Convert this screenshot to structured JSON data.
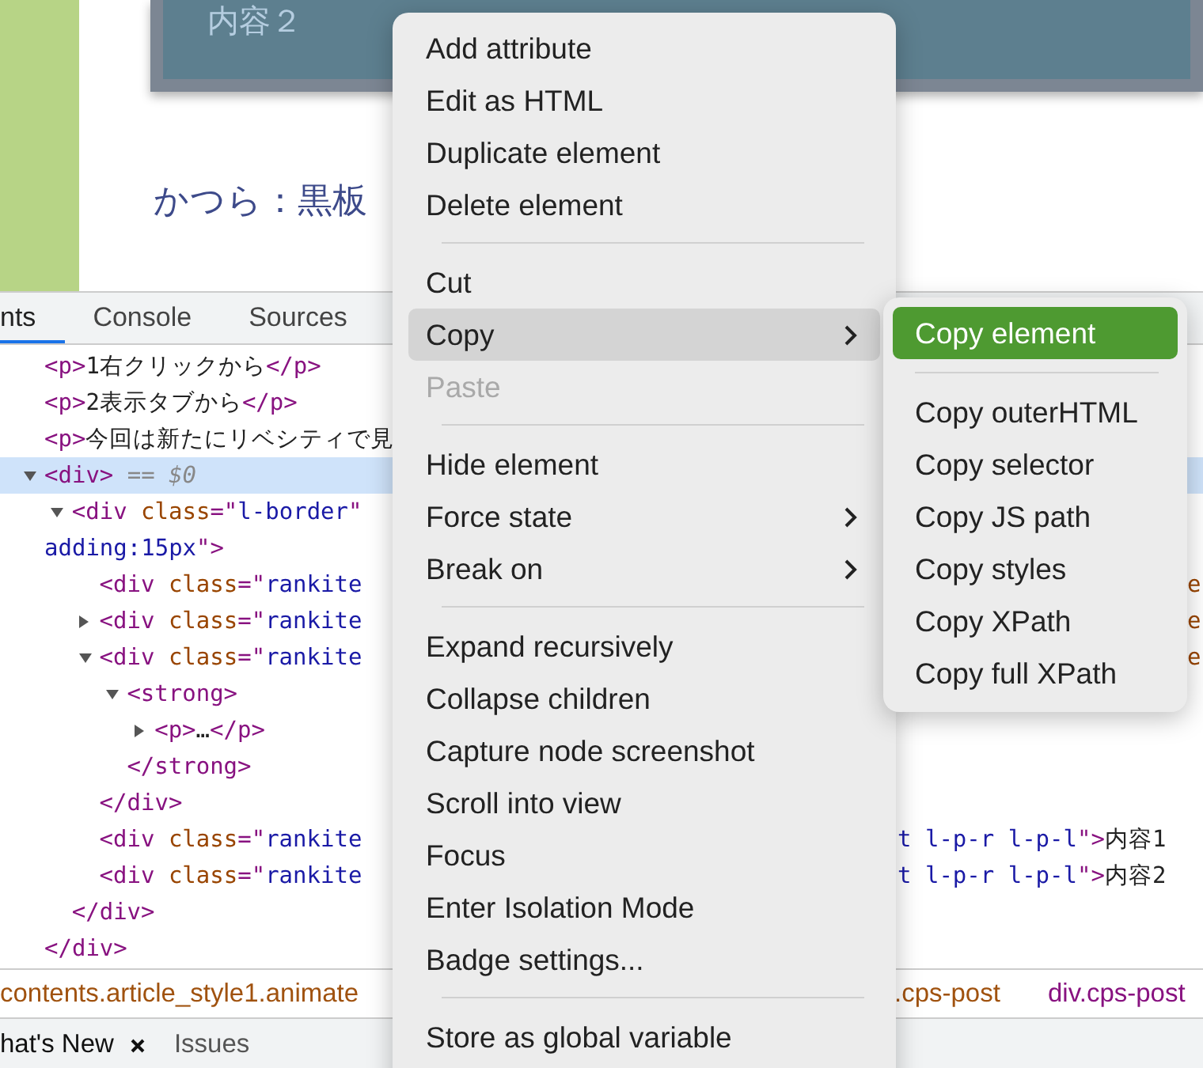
{
  "page": {
    "card_text": "内容２",
    "heading": "かつら：黒板"
  },
  "devtools": {
    "tabs": [
      {
        "label": "nts",
        "selected": true
      },
      {
        "label": "Console",
        "selected": false
      },
      {
        "label": "Sources",
        "selected": false
      }
    ],
    "nodes": [
      {
        "selected": false,
        "lines": [
          [
            {
              "kind": "tag",
              "text": "<p>"
            },
            {
              "kind": "text",
              "text": "1右クリックから"
            },
            {
              "kind": "tag",
              "text": "</p>"
            }
          ]
        ]
      },
      {
        "selected": false,
        "lines": [
          [
            {
              "kind": "tag",
              "text": "<p>"
            },
            {
              "kind": "text",
              "text": "2表示タブから"
            },
            {
              "kind": "tag",
              "text": "</p>"
            }
          ]
        ]
      },
      {
        "selected": false,
        "lines": [
          [
            {
              "kind": "tag",
              "text": "<p>"
            },
            {
              "kind": "text",
              "text": "今回は新たにリベシティで見"
            }
          ]
        ]
      },
      {
        "selected": true,
        "expanded": true,
        "lines": [
          [
            {
              "kind": "tag",
              "text": "<div>"
            },
            {
              "kind": "marker",
              "text": " == $0"
            }
          ]
        ],
        "close": [
          {
            "kind": "tag",
            "text": "</div>"
          }
        ],
        "children": [
          {
            "selected": false,
            "expanded": true,
            "lines": [
              [
                {
                  "kind": "tag",
                  "text": "<div "
                },
                {
                  "kind": "attr",
                  "text": "class"
                },
                {
                  "kind": "tag",
                  "text": "=\""
                },
                {
                  "kind": "value",
                  "text": "l-border"
                },
                {
                  "kind": "tag",
                  "text": "\""
                }
              ],
              [
                {
                  "kind": "value",
                  "text": "adding:15px"
                },
                {
                  "kind": "tag",
                  "text": "\">"
                }
              ]
            ],
            "close": [
              {
                "kind": "tag",
                "text": "</div>"
              }
            ],
            "children": [
              {
                "selected": false,
                "lines": [
                  [
                    {
                      "kind": "tag",
                      "text": "<div "
                    },
                    {
                      "kind": "attr",
                      "text": "class"
                    },
                    {
                      "kind": "tag",
                      "text": "=\""
                    },
                    {
                      "kind": "value",
                      "text": "rankite"
                    }
                  ]
                ],
                "at_edge": [
                  {
                    "kind": "attr",
                    "text": "e"
                  }
                ]
              },
              {
                "selected": false,
                "expanded": false,
                "lines": [
                  [
                    {
                      "kind": "tag",
                      "text": "<div "
                    },
                    {
                      "kind": "attr",
                      "text": "class"
                    },
                    {
                      "kind": "tag",
                      "text": "=\""
                    },
                    {
                      "kind": "value",
                      "text": "rankite"
                    }
                  ]
                ],
                "at_edge": [
                  {
                    "kind": "attr",
                    "text": "e"
                  }
                ]
              },
              {
                "selected": false,
                "expanded": true,
                "lines": [
                  [
                    {
                      "kind": "tag",
                      "text": "<div "
                    },
                    {
                      "kind": "attr",
                      "text": "class"
                    },
                    {
                      "kind": "tag",
                      "text": "=\""
                    },
                    {
                      "kind": "value",
                      "text": "rankite"
                    }
                  ]
                ],
                "at_edge": [
                  {
                    "kind": "attr",
                    "text": "e"
                  }
                ],
                "close": [
                  {
                    "kind": "tag",
                    "text": "</div>"
                  }
                ],
                "children": [
                  {
                    "selected": false,
                    "expanded": true,
                    "lines": [
                      [
                        {
                          "kind": "tag",
                          "text": "<strong>"
                        }
                      ]
                    ],
                    "close": [
                      {
                        "kind": "tag",
                        "text": "</strong>"
                      }
                    ],
                    "children": [
                      {
                        "selected": false,
                        "expanded": false,
                        "lines": [
                          [
                            {
                              "kind": "tag",
                              "text": "<p>"
                            },
                            {
                              "kind": "text",
                              "text": "…"
                            },
                            {
                              "kind": "tag",
                              "text": "</p>"
                            }
                          ]
                        ]
                      }
                    ]
                  }
                ]
              },
              {
                "selected": false,
                "lines": [
                  [
                    {
                      "kind": "tag",
                      "text": "<div "
                    },
                    {
                      "kind": "attr",
                      "text": "class"
                    },
                    {
                      "kind": "tag",
                      "text": "=\""
                    },
                    {
                      "kind": "value",
                      "text": "rankite"
                    }
                  ]
                ],
                "after_menu": [
                  {
                    "kind": "value",
                    "text": "t l-p-r l-p-l"
                  },
                  {
                    "kind": "tag",
                    "text": "\">"
                  },
                  {
                    "kind": "text",
                    "text": "内容1"
                  }
                ]
              },
              {
                "selected": false,
                "lines": [
                  [
                    {
                      "kind": "tag",
                      "text": "<div "
                    },
                    {
                      "kind": "attr",
                      "text": "class"
                    },
                    {
                      "kind": "tag",
                      "text": "=\""
                    },
                    {
                      "kind": "value",
                      "text": "rankite"
                    }
                  ]
                ],
                "after_menu": [
                  {
                    "kind": "value",
                    "text": "t l-p-r l-p-l"
                  },
                  {
                    "kind": "tag",
                    "text": "\">"
                  },
                  {
                    "kind": "text",
                    "text": "内容2"
                  }
                ]
              }
            ]
          }
        ]
      }
    ],
    "breadcrumbs": [
      {
        "text": "contents.article_style1.animate",
        "kind": "class"
      },
      {
        "text": ".cps-post",
        "kind": "class"
      },
      {
        "text": "div.cps-post",
        "kind": "element"
      }
    ],
    "drawer_tabs": [
      {
        "label": "hat's New",
        "closable": true
      },
      {
        "label": "Issues"
      }
    ]
  },
  "context_menu": {
    "items": [
      {
        "kind": "item",
        "label": "Add attribute",
        "disabled": false,
        "highlighted": false,
        "submenu": false
      },
      {
        "kind": "item",
        "label": "Edit as HTML",
        "disabled": false,
        "highlighted": false,
        "submenu": false
      },
      {
        "kind": "item",
        "label": "Duplicate element",
        "disabled": false,
        "highlighted": false,
        "submenu": false
      },
      {
        "kind": "item",
        "label": "Delete element",
        "disabled": false,
        "highlighted": false,
        "submenu": false
      },
      {
        "kind": "separator"
      },
      {
        "kind": "item",
        "label": "Cut",
        "disabled": false,
        "highlighted": false,
        "submenu": false
      },
      {
        "kind": "item",
        "label": "Copy",
        "disabled": false,
        "highlighted": true,
        "submenu": true
      },
      {
        "kind": "item",
        "label": "Paste",
        "disabled": true,
        "highlighted": false,
        "submenu": false
      },
      {
        "kind": "separator"
      },
      {
        "kind": "item",
        "label": "Hide element",
        "disabled": false,
        "highlighted": false,
        "submenu": false
      },
      {
        "kind": "item",
        "label": "Force state",
        "disabled": false,
        "highlighted": false,
        "submenu": true
      },
      {
        "kind": "item",
        "label": "Break on",
        "disabled": false,
        "highlighted": false,
        "submenu": true
      },
      {
        "kind": "separator"
      },
      {
        "kind": "item",
        "label": "Expand recursively",
        "disabled": false,
        "highlighted": false,
        "submenu": false
      },
      {
        "kind": "item",
        "label": "Collapse children",
        "disabled": false,
        "highlighted": false,
        "submenu": false
      },
      {
        "kind": "item",
        "label": "Capture node screenshot",
        "disabled": false,
        "highlighted": false,
        "submenu": false
      },
      {
        "kind": "item",
        "label": "Scroll into view",
        "disabled": false,
        "highlighted": false,
        "submenu": false
      },
      {
        "kind": "item",
        "label": "Focus",
        "disabled": false,
        "highlighted": false,
        "submenu": false
      },
      {
        "kind": "item",
        "label": "Enter Isolation Mode",
        "disabled": false,
        "highlighted": false,
        "submenu": false
      },
      {
        "kind": "item",
        "label": "Badge settings...",
        "disabled": false,
        "highlighted": false,
        "submenu": false
      },
      {
        "kind": "separator"
      },
      {
        "kind": "item",
        "label": "Store as global variable",
        "disabled": false,
        "highlighted": false,
        "submenu": false
      }
    ]
  },
  "submenu": {
    "items": [
      {
        "kind": "item",
        "label": "Copy element",
        "selected": true
      },
      {
        "kind": "separator"
      },
      {
        "kind": "item",
        "label": "Copy outerHTML",
        "selected": false
      },
      {
        "kind": "item",
        "label": "Copy selector",
        "selected": false
      },
      {
        "kind": "item",
        "label": "Copy JS path",
        "selected": false
      },
      {
        "kind": "item",
        "label": "Copy styles",
        "selected": false
      },
      {
        "kind": "item",
        "label": "Copy XPath",
        "selected": false
      },
      {
        "kind": "item",
        "label": "Copy full XPath",
        "selected": false
      }
    ]
  }
}
